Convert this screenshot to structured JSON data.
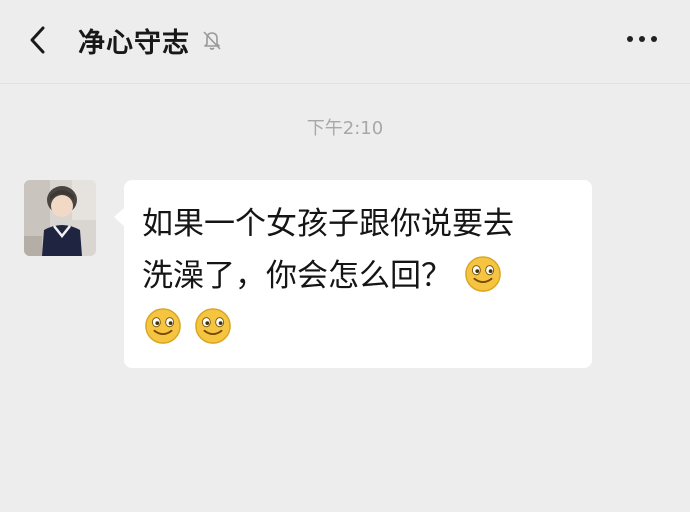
{
  "header": {
    "title": "净心守志",
    "icons": {
      "back": "chevron-left-icon",
      "mute": "bell-off-icon",
      "more": "more-horizontal-icon"
    }
  },
  "chat": {
    "timestamp": "下午2:10",
    "message": {
      "line1": "如果一个女孩子跟你说要去",
      "line2": "洗澡了，你会怎么回？",
      "emoji": "smiley-face-emoji",
      "emoji_count": 3
    }
  },
  "colors": {
    "background": "#ededed",
    "bubble": "#ffffff",
    "text": "#151515",
    "timestamp": "#a8a8a8",
    "emoji_face": "#f5c542"
  }
}
